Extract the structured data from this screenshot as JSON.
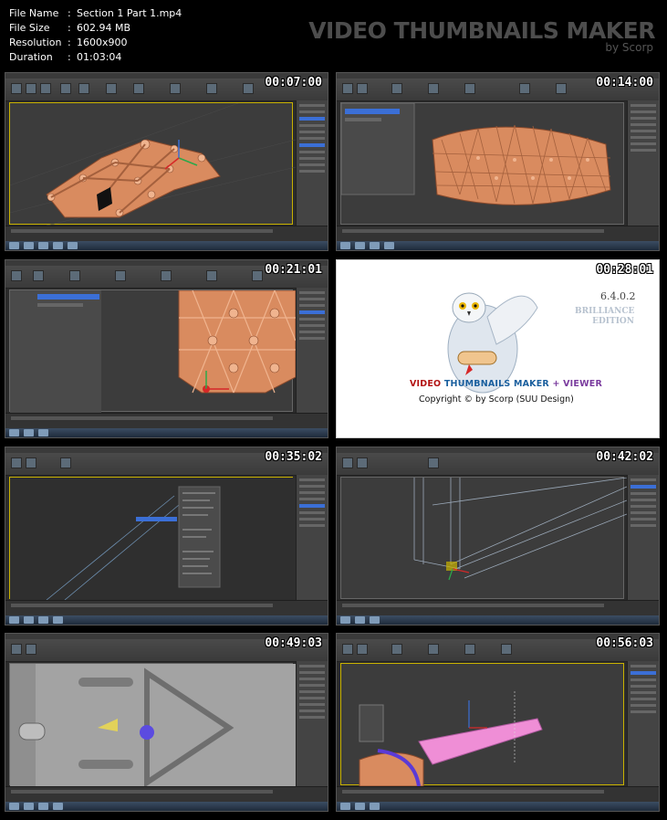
{
  "file_info": [
    {
      "key": "File Name",
      "sep": ":",
      "value": "Section 1 Part 1.mp4"
    },
    {
      "key": "File Size",
      "sep": ":",
      "value": "602.94 MB"
    },
    {
      "key": "Resolution",
      "sep": ":",
      "value": "1600x900"
    },
    {
      "key": "Duration",
      "sep": ":",
      "value": "01:03:04"
    }
  ],
  "brand": {
    "title": "VIDEO THUMBNAILS MAKER",
    "subtitle": "by Scorp"
  },
  "thumbnails": [
    {
      "timestamp": "00:07:00"
    },
    {
      "timestamp": "00:14:00"
    },
    {
      "timestamp": "00:21:01"
    },
    {
      "timestamp": "00:28:01"
    },
    {
      "timestamp": "00:35:02"
    },
    {
      "timestamp": "00:42:02"
    },
    {
      "timestamp": "00:49:03"
    },
    {
      "timestamp": "00:56:03"
    }
  ],
  "splash": {
    "version": "6.4.0.2",
    "edition_line1": "BRILLIANCE",
    "edition_line2": "EDITION",
    "name_part1": "VIDEO",
    "name_part2": "THUMBNAILS MAKER",
    "name_plus": "+",
    "name_part3": "VIEWER",
    "copyright": "Copyright © by Scorp (SUU Design)"
  },
  "colors": {
    "mesh": "#d98b5f",
    "mesh_dark": "#a4603d",
    "mesh_highlight": "#f0b48f",
    "pink_object": "#ef8ed6",
    "selection_blue": "#3b6fd6"
  }
}
